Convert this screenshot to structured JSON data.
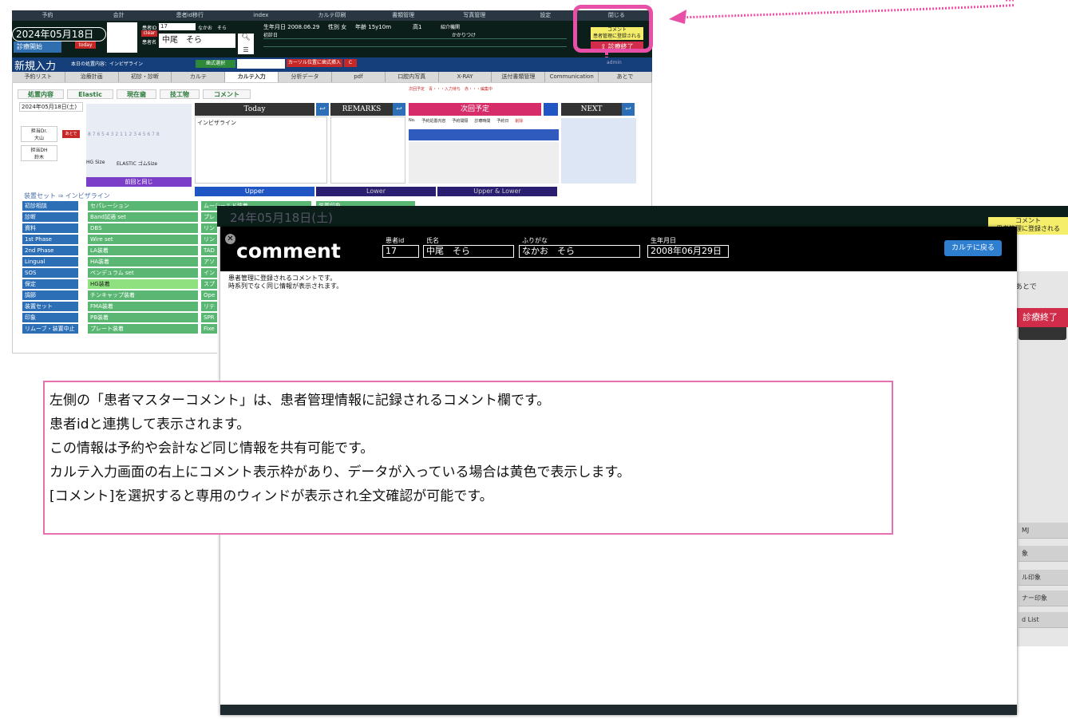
{
  "nav": [
    "予約",
    "会計",
    "患者id移行",
    "index",
    "カルテ印刷",
    "書類管理",
    "写真管理",
    "設定",
    "閉じる"
  ],
  "header": {
    "date": "2024年05月18日(土)",
    "start": "診療開始",
    "today": "today",
    "clear": "clear",
    "patient_id_label": "患者ID",
    "patient_id": "17",
    "kana": "なかお　そら",
    "name_label": "患者名",
    "name": "中尾　そら",
    "dob_label": "生年月日",
    "dob": "2008.06.29",
    "sex_label": "性別",
    "sex": "女",
    "age_label": "年齢",
    "age": "15y10m",
    "grade": "高1",
    "referral": "紹介機関",
    "shoshin": "初診日",
    "kakari": "かかりつけ",
    "comment_label": "コメント",
    "comment_note": "患者管理に登録される",
    "end": "診療終了"
  },
  "newrow": {
    "title": "新規入力",
    "content": "本日の処置内容：インビザライン",
    "select": "歯式選択",
    "cursor": "カーソル位置に歯式挿入",
    "c": "C",
    "admin": "admin"
  },
  "tabs": [
    "予約リスト",
    "治療計画",
    "初診・診断",
    "カルテ",
    "カルテ入力",
    "分析データ",
    "pdf",
    "口腔内写真",
    "X-RAY",
    "送付書類管理",
    "Communication",
    "あとで"
  ],
  "subtabs": [
    "処置内容",
    "Elastic",
    "現在歯",
    "技工物",
    "コメント"
  ],
  "legend": "次回予定　青・・・入力待ち　赤・・・編集中",
  "panel": {
    "date": "2024年05月18日(土)",
    "dr_label": "担当Dr.",
    "dr": "大山",
    "dh_label": "担当DH",
    "dh": "鈴木",
    "later": "あとで",
    "teeth": "8 7 6 5 4 3 2 1 1 2 3 4 5 6 7 8",
    "hg": "HG Size",
    "elastic": "ELASTIC ゴムSize",
    "same": "前回と同じ",
    "today": "Today",
    "remarks": "REMARKS",
    "next_plan": "次回予定",
    "next": "NEXT",
    "invisalign": "インビザライン",
    "cols": [
      "No.",
      "予約処置内容",
      "予約間隔",
      "診療時間",
      "予約日",
      "削除"
    ],
    "upper": "Upper",
    "lower": "Lower",
    "ul": "Upper & Lower",
    "set_title": "装置セット ⇒ インビザライン"
  },
  "left_list": [
    "初診相談",
    "診断",
    "資料",
    "1st Phase",
    "2nd Phase",
    "Lingual",
    "SOS",
    "保定",
    "調節",
    "装置セット",
    "印象",
    "リムーブ・装置中止"
  ],
  "mid_list": [
    "セパレーション",
    "Band試適 set",
    "DBS",
    "Wire set",
    "LA装着",
    "HA装着",
    "ペンデュラム set",
    "HG装着",
    "チンキャップ装着",
    "FMA装着",
    "PB装着",
    "プレート装着"
  ],
  "mid_list2": [
    "ムーシールド装着",
    "プレ",
    "リン",
    "リン",
    "TAD",
    "アソ",
    "イン",
    "スプ",
    "Ope",
    "リテ",
    "SPR",
    "Fixe"
  ],
  "right_list": [
    "装置印象"
  ],
  "right_col": [
    "MJ",
    "象",
    "ル印象",
    "ナー印象",
    "d List"
  ],
  "bg_date": "24年05月18日(土)",
  "modal": {
    "title": "comment",
    "id_label": "患者id",
    "id": "17",
    "name_label": "氏名",
    "name": "中尾　そら",
    "kana_label": "ふりがな",
    "kana": "なかお　そら",
    "dob_label": "生年月日",
    "dob": "2008年06月29日",
    "back": "カルテに戻る",
    "body1": "患者管理に登録されるコメントです。",
    "body2": "時系列でなく同じ情報が表示されます。"
  },
  "callout": [
    "左側の「患者マスターコメント」は、患者管理情報に記録されるコメント欄です。",
    "患者idと連携して表示されます。",
    "この情報は予約や会計など同じ情報を共有可能です。",
    "カルテ入力画面の右上にコメント表示枠があり、データが入っている場合は黄色で表示します。",
    "[コメント]を選択すると専用のウィンドが表示され全文確認が可能です。"
  ],
  "colors": {
    "accent_pink": "#e84fa7",
    "header_dark": "#0b1e1a",
    "nav_blue": "#153f7a",
    "green": "#5ab673",
    "blue": "#2c6fb6"
  }
}
